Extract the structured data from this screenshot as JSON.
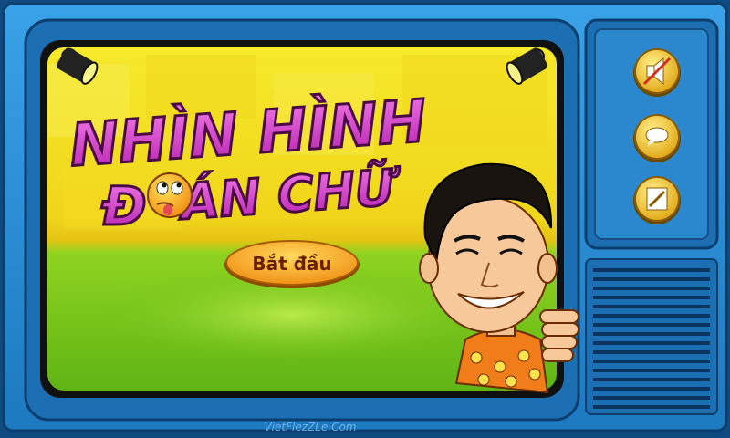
{
  "game": {
    "title_line1": "NHÌN HÌNH",
    "title_line2_prefix": "Đ",
    "title_line2_suffix": "ÁN CHỮ",
    "start_label": "Bắt đầu",
    "watermark": "VietFlezZLe.Com"
  },
  "side_buttons": [
    {
      "name": "sound-mute-button",
      "icon": "muted-speaker-icon"
    },
    {
      "name": "chat-button",
      "icon": "speech-bubble-icon"
    },
    {
      "name": "edit-button",
      "icon": "pencil-icon"
    }
  ],
  "colors": {
    "tv_body": "#2a8fd6",
    "tv_frame_dark": "#124e86",
    "screen_yellow": "#f3e21e",
    "screen_green": "#7ccb1c",
    "title_pink": "#d638c8",
    "button_orange": "#f6a51e",
    "button_gold": "#f3c419"
  }
}
